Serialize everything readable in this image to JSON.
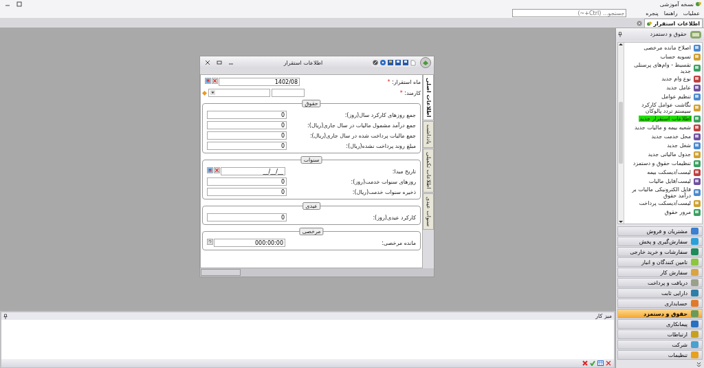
{
  "app_title": "نسخه آموزشی",
  "menu": [
    "عملیات",
    "راهنما",
    "پنجره"
  ],
  "search": {
    "placeholder": "جستجو... (Ctrl+~)"
  },
  "doc_tabs": [
    {
      "label": "اطلاعات استقرار",
      "selected": true
    }
  ],
  "sidebar": {
    "title": "حقوق و دستمزد",
    "items": [
      {
        "label": "اصلاح مانده مرخصی",
        "selected": false
      },
      {
        "label": "تسویه حساب",
        "selected": false
      },
      {
        "label": "تقسیط - وام‌های پرسنلی جدید",
        "selected": false
      },
      {
        "label": "نوع وام جدید",
        "selected": false
      },
      {
        "label": "عامل جدید",
        "selected": false
      },
      {
        "label": "تنظیم عوامل",
        "selected": false
      },
      {
        "label": "نگاشت عوامل کارکرد سیستم تردد پالوکان",
        "selected": false
      },
      {
        "label": "اطلاعات استقرار جدید",
        "selected": true
      },
      {
        "label": "شعبه بیمه و مالیات جدید",
        "selected": false
      },
      {
        "label": "محل خدمت جدید",
        "selected": false
      },
      {
        "label": "شغل جدید",
        "selected": false
      },
      {
        "label": "جدول مالیاتی جدید",
        "selected": false
      },
      {
        "label": "تنظیمات حقوق و دستمزد",
        "selected": false
      },
      {
        "label": "لیست/دیسکت بیمه",
        "selected": false
      },
      {
        "label": "لیست/فایل مالیات",
        "selected": false
      },
      {
        "label": "فایل الکترونیکی مالیات بر درآمد حقوق",
        "selected": false
      },
      {
        "label": "لیست/دیسکت پرداخت",
        "selected": false
      },
      {
        "label": "مرور حقوق",
        "selected": false
      }
    ]
  },
  "nav": [
    {
      "label": "مشتریان و فروش",
      "selected": false,
      "color": "#3a7fd0"
    },
    {
      "label": "سفارش‌گیری و پخش",
      "selected": false,
      "color": "#2aa0d8"
    },
    {
      "label": "سفارشات و خرید خارجی",
      "selected": false,
      "color": "#1f8a5a"
    },
    {
      "label": "تامین کنندگان و انبار",
      "selected": false,
      "color": "#8cc63f"
    },
    {
      "label": "سفارش کار",
      "selected": false,
      "color": "#d9a441"
    },
    {
      "label": "دریافت و پرداخت",
      "selected": false,
      "color": "#9aa08a"
    },
    {
      "label": "دارایی ثابت",
      "selected": false,
      "color": "#2e7fa8"
    },
    {
      "label": "حسابداری",
      "selected": false,
      "color": "#e07a2a"
    },
    {
      "label": "حقوق و دستمزد",
      "selected": true,
      "color": "#6a9a5a"
    },
    {
      "label": "پیمانکاری",
      "selected": false,
      "color": "#2a70c0"
    },
    {
      "label": "ارتباطات",
      "selected": false,
      "color": "#c8a020"
    },
    {
      "label": "شرکت",
      "selected": false,
      "color": "#4aa0d0"
    },
    {
      "label": "تنظیمات",
      "selected": false,
      "color": "#e8a020"
    }
  ],
  "dialog": {
    "title": "اطلاعات استقرار",
    "tabs": [
      {
        "label": "اطلاعات اصلی",
        "selected": true
      },
      {
        "label": "یادداشت",
        "selected": false
      },
      {
        "label": "اطلاعات تکمیلی",
        "selected": false
      },
      {
        "label": "سنوات عیدی",
        "selected": false
      }
    ],
    "month": {
      "label": "ماه استقرار:",
      "marker": "*",
      "value": "1402/08"
    },
    "employee": {
      "label": "کارمند:",
      "marker": "*"
    },
    "groups": [
      {
        "title": "حقوق",
        "rows": [
          {
            "kind": "number",
            "label": "جمع روزهای کارکرد سال(روز):",
            "value": "0"
          },
          {
            "kind": "number",
            "label": "جمع درآمد مشمول مالیات در سال جاری(ریال):",
            "value": "0"
          },
          {
            "kind": "number",
            "label": "جمع مالیات پرداخت شده در سال جاری(ریال):",
            "value": "0"
          },
          {
            "kind": "number",
            "label": "مبلغ روند پرداخت نشده(ریال):",
            "value": "0"
          }
        ]
      },
      {
        "title": "سنوات",
        "rows": [
          {
            "kind": "date",
            "label": "تاریخ مبدا:",
            "value": "__/__/__"
          },
          {
            "kind": "number",
            "label": "روزهای سنوات خدمت(روز):",
            "value": "0"
          },
          {
            "kind": "number",
            "label": "ذخیره سنوات خدمت(ریال):",
            "value": "0"
          }
        ]
      },
      {
        "title": "عیدی",
        "rows": [
          {
            "kind": "number",
            "label": "کارکرد عیدی(روز):",
            "value": "0"
          }
        ]
      },
      {
        "title": "مرخصی",
        "rows": [
          {
            "kind": "time",
            "label": "مانده مرخصی:",
            "value": "000:00:00"
          }
        ]
      }
    ]
  },
  "bottom_panel": {
    "title": "میز کار"
  }
}
